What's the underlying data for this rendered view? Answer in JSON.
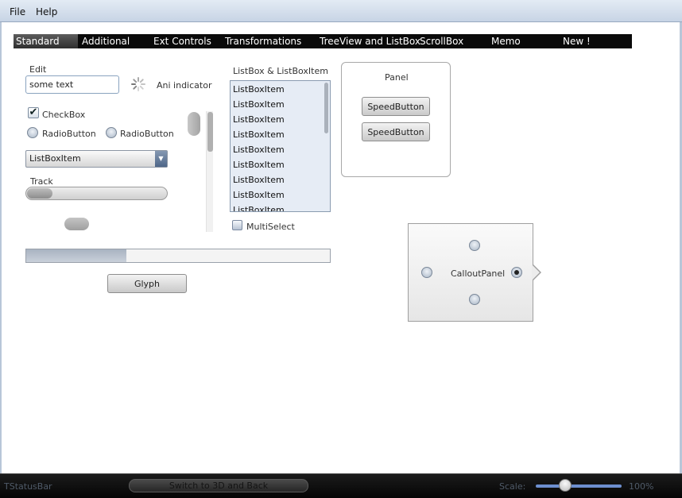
{
  "menu": {
    "items": [
      "File",
      "Help"
    ]
  },
  "tabs": [
    {
      "label": "Standard",
      "active": true
    },
    {
      "label": "Additional",
      "active": false
    },
    {
      "label": "Ext Controls",
      "active": false
    },
    {
      "label": "Transformations",
      "active": false
    },
    {
      "label": "TreeView and ListBox",
      "active": false
    },
    {
      "label": "ScrollBox",
      "active": false
    },
    {
      "label": "Memo",
      "active": false
    },
    {
      "label": "New !",
      "active": false
    }
  ],
  "edit": {
    "label": "Edit",
    "value": "some text"
  },
  "ani_indicator": {
    "label": "Ani indicator"
  },
  "checkbox": {
    "label": "CheckBox",
    "checked": true
  },
  "radios": [
    {
      "label": "RadioButton"
    },
    {
      "label": "RadioButton"
    }
  ],
  "combo": {
    "selected": "ListBoxItem"
  },
  "track": {
    "label": "Track",
    "value_fraction": 0.18
  },
  "listbox": {
    "title": "ListBox & ListBoxItem",
    "items": [
      "ListBoxItem",
      "ListBoxItem",
      "ListBoxItem",
      "ListBoxItem",
      "ListBoxItem",
      "ListBoxItem",
      "ListBoxItem",
      "ListBoxItem",
      "ListBoxItem"
    ]
  },
  "multiselect": {
    "label": "MultiSelect",
    "checked": false
  },
  "panel": {
    "title": "Panel",
    "buttons": [
      "SpeedButton",
      "SpeedButton"
    ]
  },
  "progress": {
    "value_percent": 33
  },
  "glyph_button": {
    "label": "Glyph"
  },
  "callout": {
    "label": "CalloutPanel",
    "checked_radio": "right"
  },
  "statusbar": {
    "title": "TStatusBar",
    "switch_button": "Switch to 3D and Back",
    "scale_label": "Scale:",
    "scale_value": "100%",
    "scale_fraction": 0.33
  }
}
